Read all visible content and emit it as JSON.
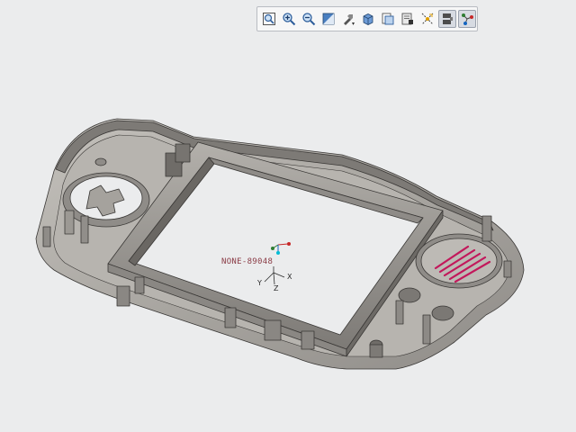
{
  "toolbar": {
    "buttons": [
      {
        "icon": "zoom-fit-icon"
      },
      {
        "icon": "zoom-in-icon"
      },
      {
        "icon": "zoom-out-icon"
      },
      {
        "icon": "repaint-icon"
      },
      {
        "icon": "spin-center-icon"
      },
      {
        "icon": "display-style-icon"
      },
      {
        "icon": "saved-views-icon"
      },
      {
        "icon": "view-manager-icon"
      },
      {
        "icon": "datum-display-icon"
      },
      {
        "icon": "annotation-display-icon",
        "active": true
      },
      {
        "icon": "spin-center-toggle-icon",
        "active": true
      }
    ]
  },
  "model": {
    "csys_label": "NONE-89048",
    "axes": {
      "x": "X",
      "y": "Y",
      "z": "Z"
    }
  },
  "colors": {
    "background": "#ebeced",
    "shell": "#a8a5a0",
    "shell_dark": "#6f6c68",
    "shell_light": "#c9c6c1",
    "edge": "#3a3836",
    "label": "#8a3b45",
    "highlight": "#c2185b"
  }
}
